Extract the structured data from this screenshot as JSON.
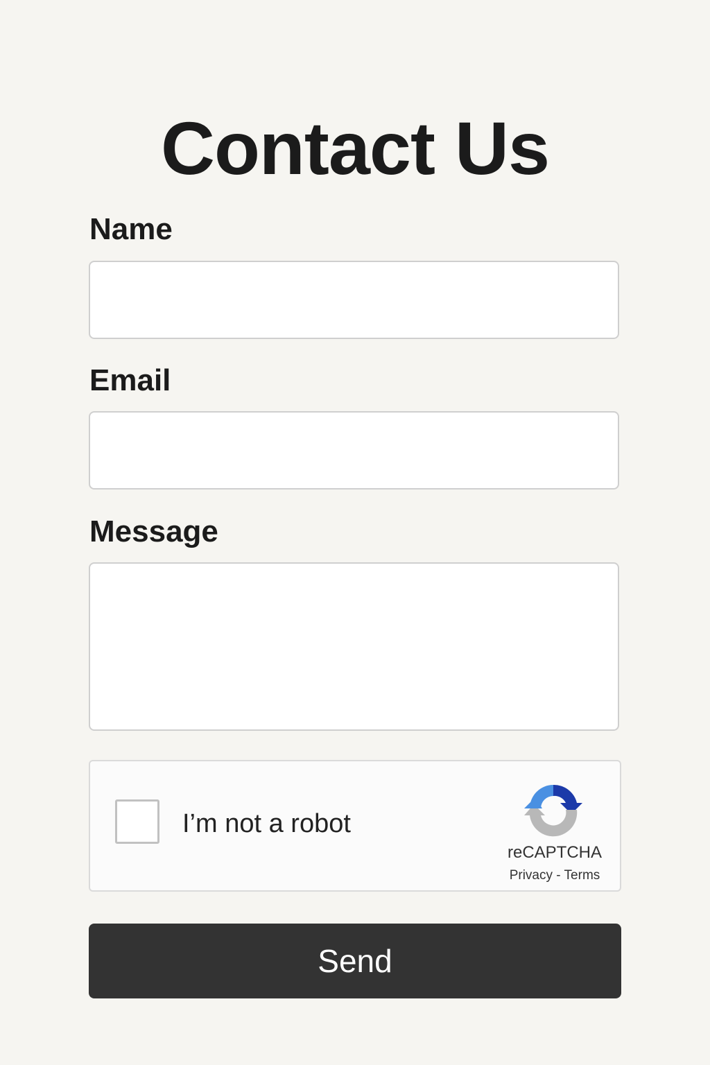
{
  "header": {
    "title": "Contact Us"
  },
  "form": {
    "name": {
      "label": "Name",
      "value": "",
      "placeholder": ""
    },
    "email": {
      "label": "Email",
      "value": "",
      "placeholder": ""
    },
    "message": {
      "label": "Message",
      "value": "",
      "placeholder": ""
    }
  },
  "recaptcha": {
    "checkbox_label": "I’m not a robot",
    "checked": false,
    "brand": "reCAPTCHA",
    "privacy_link": "Privacy",
    "separator": " - ",
    "terms_link": "Terms",
    "icon": "recaptcha-logo-icon",
    "colors": {
      "arrow_blue": "#4a90e2",
      "arrow_dark_blue": "#1c3aa9",
      "arrow_gray": "#b8b8b8"
    }
  },
  "actions": {
    "send_label": "Send"
  },
  "colors": {
    "background": "#f6f5f1",
    "button": "#333333",
    "button_text": "#ffffff",
    "input_border": "#cfcfcf"
  }
}
